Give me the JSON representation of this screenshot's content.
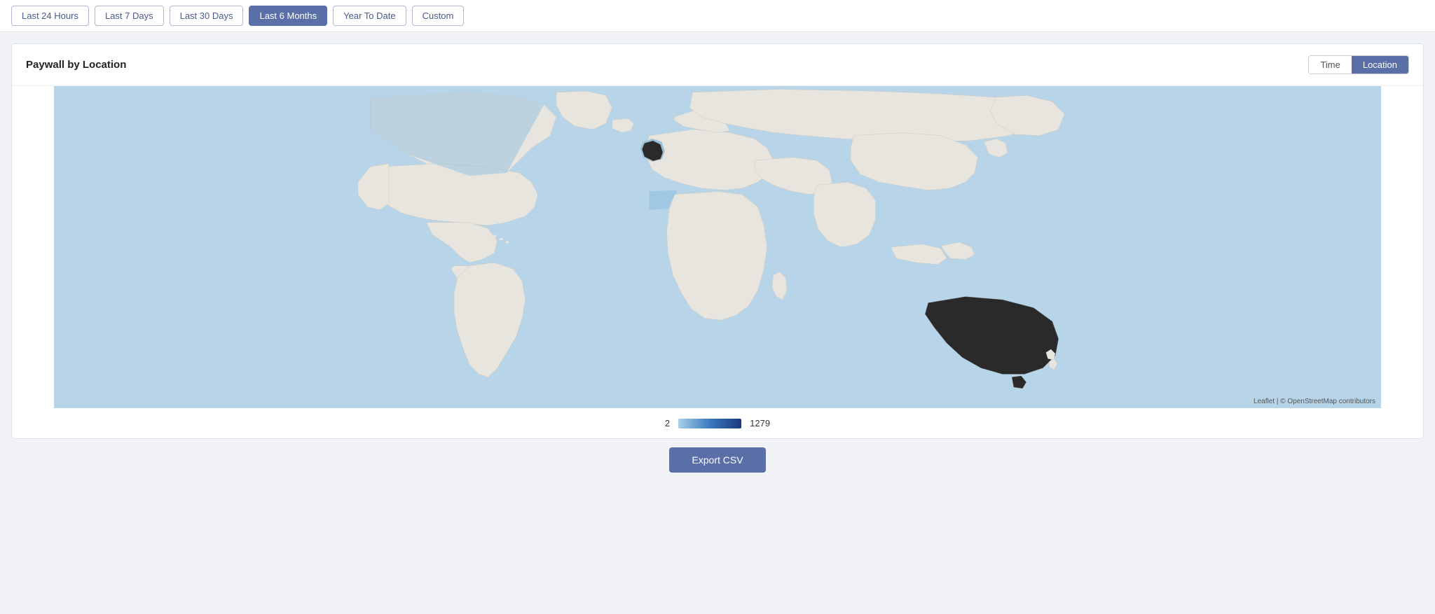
{
  "topBar": {
    "buttons": [
      {
        "id": "last24h",
        "label": "Last 24 Hours",
        "active": false
      },
      {
        "id": "last7d",
        "label": "Last 7 Days",
        "active": false
      },
      {
        "id": "last30d",
        "label": "Last 30 Days",
        "active": false
      },
      {
        "id": "last6m",
        "label": "Last 6 Months",
        "active": true
      },
      {
        "id": "ytd",
        "label": "Year To Date",
        "active": false
      },
      {
        "id": "custom",
        "label": "Custom",
        "active": false
      }
    ]
  },
  "card": {
    "title": "Paywall by Location",
    "viewButtons": [
      {
        "id": "time",
        "label": "Time",
        "active": false
      },
      {
        "id": "location",
        "label": "Location",
        "active": true
      }
    ]
  },
  "legend": {
    "minValue": "2",
    "maxValue": "1279"
  },
  "exportButton": {
    "label": "Export CSV"
  },
  "attribution": {
    "leaflet": "Leaflet",
    "osm": "OpenStreetMap",
    "contributors": " contributors"
  }
}
